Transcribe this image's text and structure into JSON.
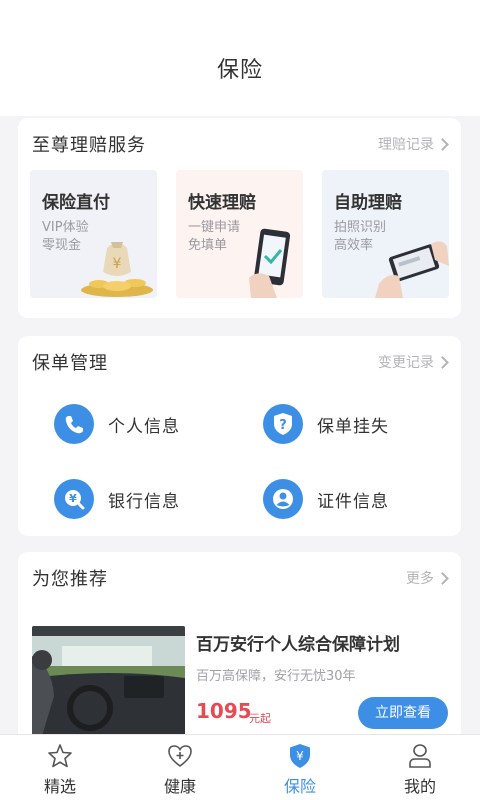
{
  "header": {
    "title": "保险"
  },
  "claims": {
    "title": "至尊理赔服务",
    "link": "理赔记录",
    "tiles": [
      {
        "name": "保险直付",
        "sub1": "VIP体验",
        "sub2": "零现金"
      },
      {
        "name": "快速理赔",
        "sub1": "一键申请",
        "sub2": "免填单"
      },
      {
        "name": "自助理赔",
        "sub1": "拍照识别",
        "sub2": "高效率"
      }
    ]
  },
  "policy": {
    "title": "保单管理",
    "link": "变更记录",
    "items": [
      {
        "label": "个人信息",
        "icon": "phone-icon"
      },
      {
        "label": "保单挂失",
        "icon": "shield-question-icon"
      },
      {
        "label": "银行信息",
        "icon": "yen-search-icon"
      },
      {
        "label": "证件信息",
        "icon": "person-icon"
      }
    ]
  },
  "recommend": {
    "title": "为您推荐",
    "link": "更多",
    "product": {
      "name": "百万安行个人综合保障计划",
      "desc": "百万高保障，安行无忧30年",
      "price": "1095",
      "unit": "元起",
      "button": "立即查看"
    }
  },
  "tabs": [
    {
      "label": "精选",
      "icon": "star-icon"
    },
    {
      "label": "健康",
      "icon": "heart-plus-icon"
    },
    {
      "label": "保险",
      "icon": "shield-yen-icon",
      "active": true
    },
    {
      "label": "我的",
      "icon": "user-icon"
    }
  ],
  "colors": {
    "accent": "#3d8fe6",
    "price": "#e54b55",
    "background": "#f4f4f6"
  }
}
